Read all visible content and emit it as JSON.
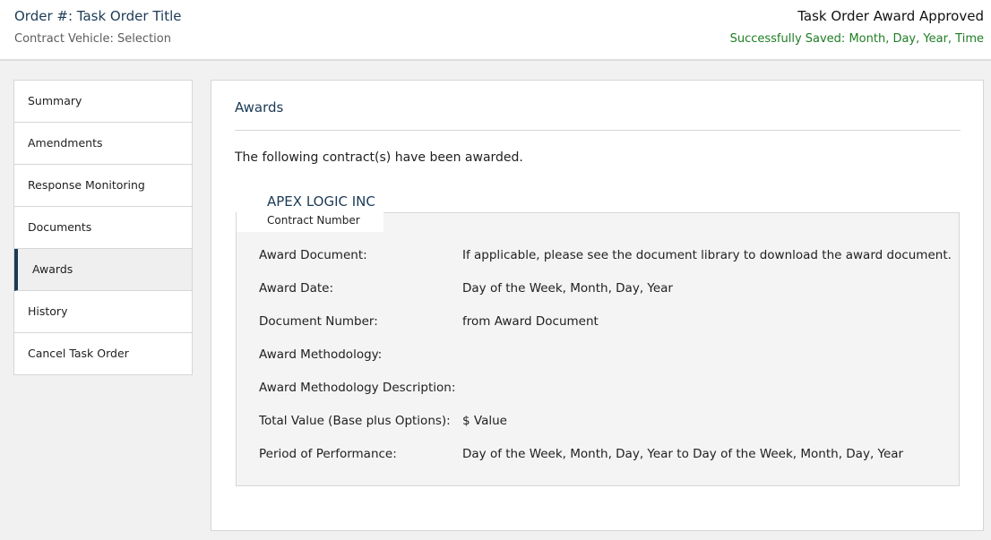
{
  "header": {
    "order_title": "Order #: Task Order Title",
    "contract_vehicle": "Contract Vehicle: Selection",
    "status": "Task Order Award Approved",
    "saved_status": "Successfully Saved: Month, Day, Year, Time"
  },
  "sidebar": {
    "items": [
      {
        "label": "Summary"
      },
      {
        "label": "Amendments"
      },
      {
        "label": "Response Monitoring"
      },
      {
        "label": "Documents"
      },
      {
        "label": "Awards"
      },
      {
        "label": "History"
      },
      {
        "label": "Cancel Task Order"
      }
    ],
    "active": "Awards"
  },
  "main": {
    "title": "Awards",
    "intro": "The following contract(s) have been awarded.",
    "award": {
      "vendor_name": "APEX LOGIC INC",
      "contract_number_label": "Contract Number",
      "fields": [
        {
          "label": "Award Document:",
          "value": "If applicable, please see the document library to download the award document."
        },
        {
          "label": "Award Date:",
          "value": "Day of the Week, Month, Day, Year"
        },
        {
          "label": "Document Number:",
          "value": "from Award Document"
        },
        {
          "label": "Award Methodology:",
          "value": ""
        },
        {
          "label": "Award Methodology Description:",
          "value": ""
        },
        {
          "label": "Total Value (Base plus Options):",
          "value": "$ Value"
        },
        {
          "label": "Period of Performance:",
          "value": "Day of the Week, Month, Day, Year to Day of the Week, Month, Day, Year"
        }
      ]
    }
  },
  "colors": {
    "accent": "#1b3a57",
    "success": "#1e7e23",
    "page_background": "#f1f1f1",
    "active_item_background": "#efefef"
  }
}
